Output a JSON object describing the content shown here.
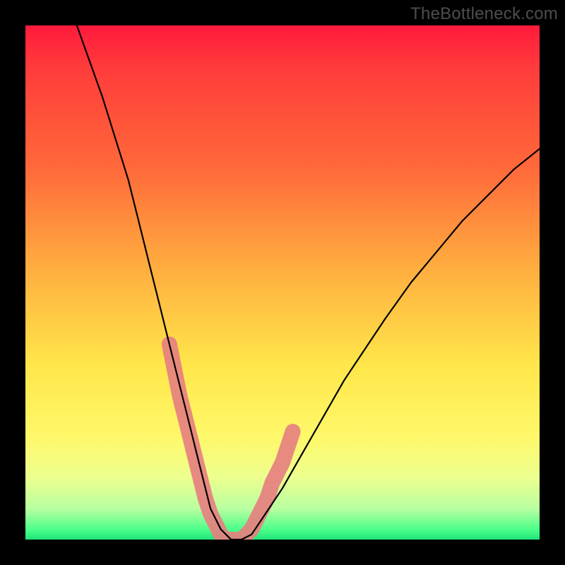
{
  "watermark": "TheBottleneck.com",
  "colors": {
    "background": "#000000",
    "curve": "#000000",
    "cluster": "#e68080",
    "gradient_top": "#ff1a3c",
    "gradient_bottom": "#1ee47a"
  },
  "chart_data": {
    "type": "line",
    "title": "",
    "xlabel": "",
    "ylabel": "",
    "xlim": [
      0,
      100
    ],
    "ylim": [
      0,
      100
    ],
    "grid": false,
    "series": [
      {
        "name": "bottleneck-curve",
        "x": [
          10,
          15,
          20,
          22,
          24,
          26,
          28,
          30,
          32,
          33,
          34,
          35,
          36,
          37,
          38,
          39,
          40,
          42,
          44,
          46,
          50,
          54,
          58,
          62,
          66,
          70,
          75,
          80,
          85,
          90,
          95,
          100
        ],
        "y": [
          100,
          86,
          70,
          62,
          54,
          46,
          38,
          30,
          22,
          18,
          14,
          10,
          6,
          4,
          2,
          1,
          0,
          0,
          1,
          4,
          10,
          17,
          24,
          31,
          37,
          43,
          50,
          56,
          62,
          67,
          72,
          76
        ]
      }
    ],
    "highlighted_points": {
      "name": "gpu-cluster",
      "x": [
        28,
        29,
        30,
        30.5,
        31,
        32,
        33,
        34,
        35,
        36,
        37,
        38,
        39,
        40,
        41,
        42,
        43,
        44,
        45,
        46,
        47,
        48,
        50,
        52
      ],
      "y": [
        38,
        33,
        28,
        26,
        24,
        20,
        16,
        12,
        8,
        5,
        3,
        1,
        0,
        0,
        0,
        0,
        1,
        2,
        4,
        6,
        8,
        11,
        15,
        21
      ]
    },
    "annotations": []
  }
}
